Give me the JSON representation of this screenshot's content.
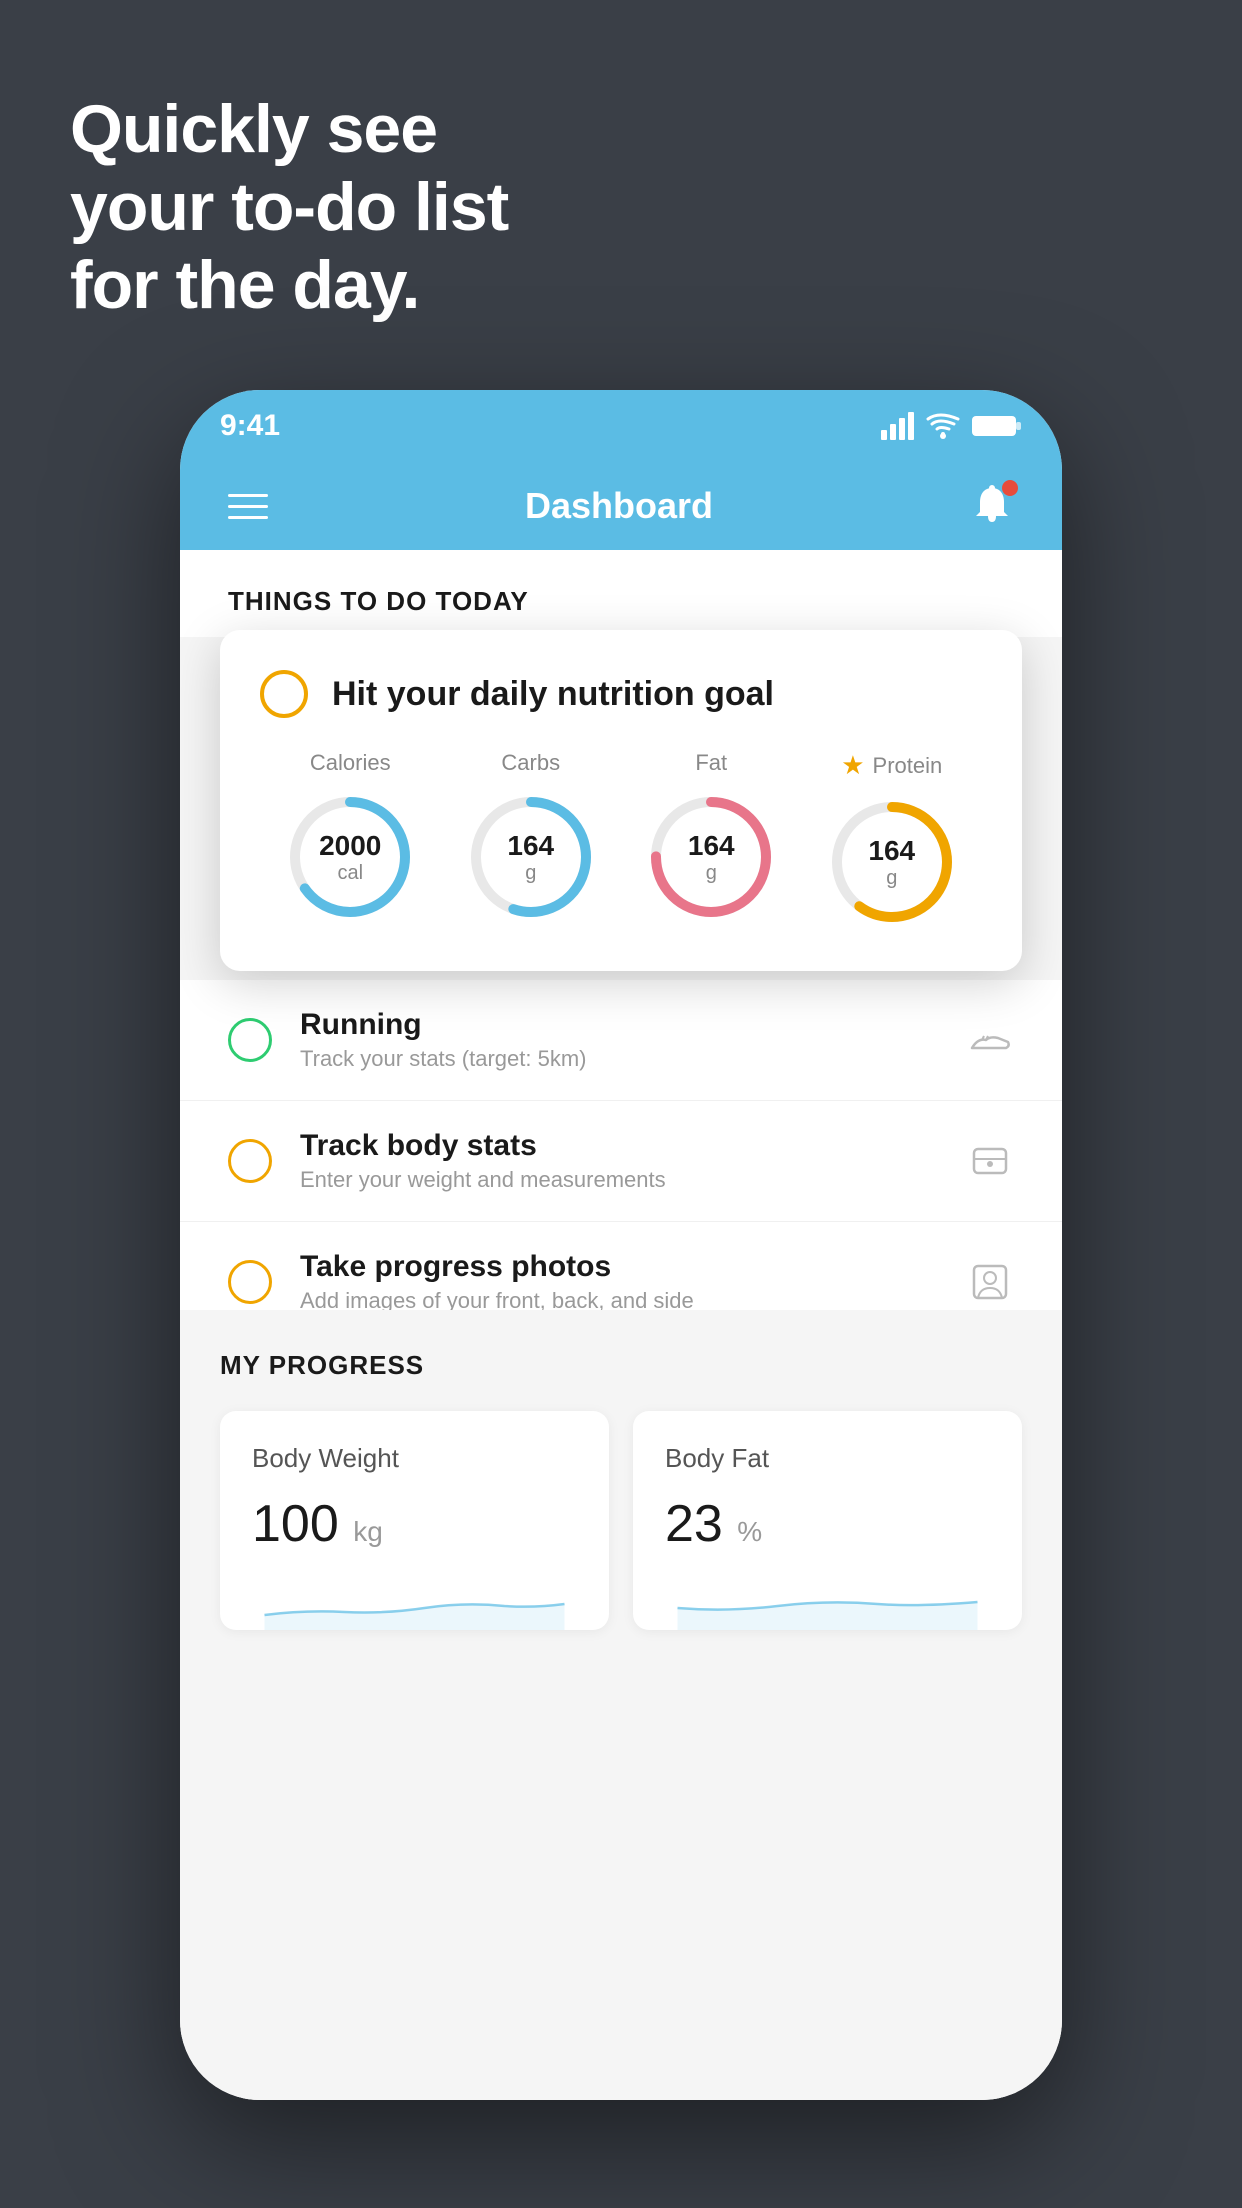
{
  "background": {
    "color": "#3a3f47"
  },
  "hero": {
    "line1": "Quickly see",
    "line2": "your to-do list",
    "line3": "for the day."
  },
  "status_bar": {
    "time": "9:41",
    "accent": "#5bbce4"
  },
  "nav": {
    "title": "Dashboard"
  },
  "things_section": {
    "label": "THINGS TO DO TODAY"
  },
  "nutrition_card": {
    "title": "Hit your daily nutrition goal",
    "stats": [
      {
        "label": "Calories",
        "value": "2000",
        "unit": "cal",
        "color": "#5bbce4",
        "pct": 65,
        "starred": false
      },
      {
        "label": "Carbs",
        "value": "164",
        "unit": "g",
        "color": "#5bbce4",
        "pct": 55,
        "starred": false
      },
      {
        "label": "Fat",
        "value": "164",
        "unit": "g",
        "color": "#e8758a",
        "pct": 75,
        "starred": false
      },
      {
        "label": "Protein",
        "value": "164",
        "unit": "g",
        "color": "#f0a500",
        "pct": 60,
        "starred": true
      }
    ]
  },
  "todo_items": [
    {
      "title": "Running",
      "subtitle": "Track your stats (target: 5km)",
      "circle_color": "green",
      "icon": "shoe"
    },
    {
      "title": "Track body stats",
      "subtitle": "Enter your weight and measurements",
      "circle_color": "yellow",
      "icon": "scale"
    },
    {
      "title": "Take progress photos",
      "subtitle": "Add images of your front, back, and side",
      "circle_color": "yellow",
      "icon": "portrait"
    }
  ],
  "progress_section": {
    "label": "MY PROGRESS",
    "cards": [
      {
        "title": "Body Weight",
        "value": "100",
        "unit": "kg"
      },
      {
        "title": "Body Fat",
        "value": "23",
        "unit": "%"
      }
    ]
  }
}
